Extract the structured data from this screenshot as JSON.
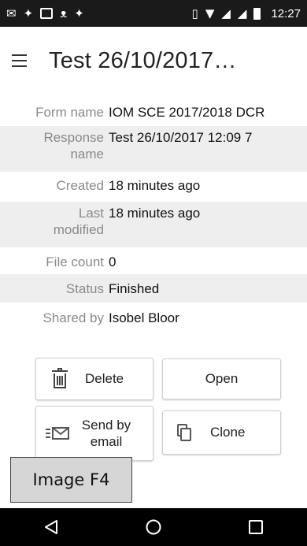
{
  "status_bar": {
    "time": "12:27",
    "left_icons": [
      "gmail-icon",
      "twitter-icon",
      "image-icon",
      "cat-icon",
      "twitter-icon"
    ],
    "right_icons": [
      "vibrate-icon",
      "wifi-icon",
      "signal-icon",
      "signal-icon",
      "battery-icon"
    ]
  },
  "app_bar": {
    "title": "Test 26/10/2017…"
  },
  "details": {
    "form_name": {
      "label": "Form name",
      "value": "IOM SCE 2017/2018 DCR"
    },
    "response_name": {
      "label_line1": "Response",
      "label_line2": "name",
      "value": "Test 26/10/2017 12:09 7"
    },
    "created": {
      "label": "Created",
      "value": "18 minutes ago"
    },
    "last_modified": {
      "label_line1": "Last",
      "label_line2": "modified",
      "value": "18 minutes ago"
    },
    "file_count": {
      "label": "File count",
      "value": "0"
    },
    "status": {
      "label": "Status",
      "value": "Finished"
    },
    "shared_by": {
      "label": "Shared by",
      "value": "Isobel Bloor"
    }
  },
  "actions": {
    "delete": "Delete",
    "open": "Open",
    "email_line1": "Send by",
    "email_line2": "email",
    "clone": "Clone"
  },
  "caption": "Image F4",
  "colors": {
    "status_bar_bg": "#1a1a1a",
    "alt_row_bg": "#eeeeee",
    "label_gray": "#8a8a8a",
    "nav_bar_bg": "#000000"
  }
}
